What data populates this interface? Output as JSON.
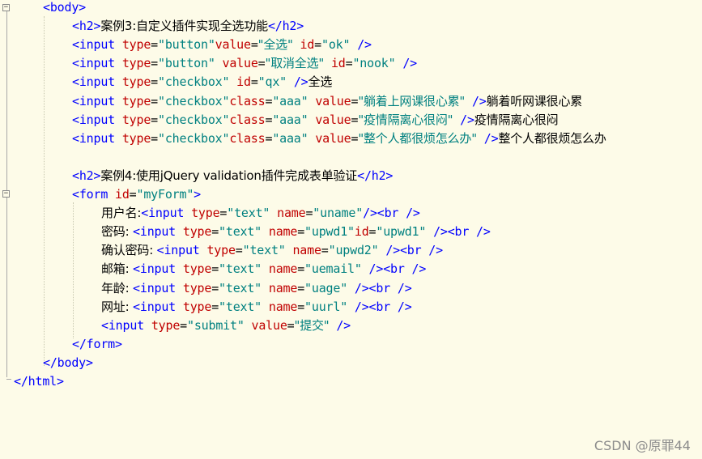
{
  "editor": {
    "lines": [
      {
        "indent": 1,
        "tokens": [
          [
            "tag",
            "<body>"
          ]
        ]
      },
      {
        "indent": 2,
        "tokens": [
          [
            "tag",
            "<h2>"
          ],
          [
            "txt",
            "案例3:自定义插件实现全选功能"
          ],
          [
            "tag",
            "</h2>"
          ]
        ]
      },
      {
        "indent": 2,
        "tokens": [
          [
            "tag",
            "<input "
          ],
          [
            "attr",
            "type"
          ],
          [
            "eq",
            "="
          ],
          [
            "val",
            "\"button\""
          ],
          [
            "attr",
            "value"
          ],
          [
            "eq",
            "="
          ],
          [
            "val",
            "\"全选\""
          ],
          [
            "txt",
            " "
          ],
          [
            "attr",
            "id"
          ],
          [
            "eq",
            "="
          ],
          [
            "val",
            "\"ok\""
          ],
          [
            "txt",
            " "
          ],
          [
            "tag",
            "/>"
          ]
        ]
      },
      {
        "indent": 2,
        "tokens": [
          [
            "tag",
            "<input "
          ],
          [
            "attr",
            "type"
          ],
          [
            "eq",
            "="
          ],
          [
            "val",
            "\"button\""
          ],
          [
            "txt",
            " "
          ],
          [
            "attr",
            "value"
          ],
          [
            "eq",
            "="
          ],
          [
            "val",
            "\"取消全选\""
          ],
          [
            "txt",
            " "
          ],
          [
            "attr",
            "id"
          ],
          [
            "eq",
            "="
          ],
          [
            "val",
            "\"nook\""
          ],
          [
            "txt",
            " "
          ],
          [
            "tag",
            "/>"
          ]
        ]
      },
      {
        "indent": 2,
        "tokens": [
          [
            "tag",
            "<input "
          ],
          [
            "attr",
            "type"
          ],
          [
            "eq",
            "="
          ],
          [
            "val",
            "\"checkbox\""
          ],
          [
            "txt",
            " "
          ],
          [
            "attr",
            "id"
          ],
          [
            "eq",
            "="
          ],
          [
            "val",
            "\"qx\""
          ],
          [
            "txt",
            " "
          ],
          [
            "tag",
            "/>"
          ],
          [
            "txt",
            "全选"
          ]
        ]
      },
      {
        "indent": 2,
        "tokens": [
          [
            "tag",
            "<input "
          ],
          [
            "attr",
            "type"
          ],
          [
            "eq",
            "="
          ],
          [
            "val",
            "\"checkbox\""
          ],
          [
            "attr",
            "class"
          ],
          [
            "eq",
            "="
          ],
          [
            "val",
            "\"aaa\""
          ],
          [
            "txt",
            " "
          ],
          [
            "attr",
            "value"
          ],
          [
            "eq",
            "="
          ],
          [
            "val",
            "\"躺着上网课很心累\""
          ],
          [
            "txt",
            " "
          ],
          [
            "tag",
            "/>"
          ],
          [
            "txt",
            "躺着听网课很心累"
          ]
        ]
      },
      {
        "indent": 2,
        "tokens": [
          [
            "tag",
            "<input "
          ],
          [
            "attr",
            "type"
          ],
          [
            "eq",
            "="
          ],
          [
            "val",
            "\"checkbox\""
          ],
          [
            "attr",
            "class"
          ],
          [
            "eq",
            "="
          ],
          [
            "val",
            "\"aaa\""
          ],
          [
            "txt",
            " "
          ],
          [
            "attr",
            "value"
          ],
          [
            "eq",
            "="
          ],
          [
            "val",
            "\"疫情隔离心很闷\""
          ],
          [
            "txt",
            " "
          ],
          [
            "tag",
            "/>"
          ],
          [
            "txt",
            "疫情隔离心很闷"
          ]
        ]
      },
      {
        "indent": 2,
        "tokens": [
          [
            "tag",
            "<input "
          ],
          [
            "attr",
            "type"
          ],
          [
            "eq",
            "="
          ],
          [
            "val",
            "\"checkbox\""
          ],
          [
            "attr",
            "class"
          ],
          [
            "eq",
            "="
          ],
          [
            "val",
            "\"aaa\""
          ],
          [
            "txt",
            " "
          ],
          [
            "attr",
            "value"
          ],
          [
            "eq",
            "="
          ],
          [
            "val",
            "\"整个人都很烦怎么办\""
          ],
          [
            "txt",
            " "
          ],
          [
            "tag",
            "/>"
          ],
          [
            "txt",
            "整个人都很烦怎么办"
          ]
        ]
      },
      {
        "indent": 0,
        "tokens": []
      },
      {
        "indent": 2,
        "tokens": [
          [
            "tag",
            "<h2>"
          ],
          [
            "txt",
            "案例4:使用jQuery validation插件完成表单验证"
          ],
          [
            "tag",
            "</h2>"
          ]
        ]
      },
      {
        "indent": 2,
        "tokens": [
          [
            "tag",
            "<form "
          ],
          [
            "attr",
            "id"
          ],
          [
            "eq",
            "="
          ],
          [
            "val",
            "\"myForm\""
          ],
          [
            "tag",
            ">"
          ]
        ]
      },
      {
        "indent": 3,
        "tokens": [
          [
            "txt",
            "用户名:"
          ],
          [
            "tag",
            "<input "
          ],
          [
            "attr",
            "type"
          ],
          [
            "eq",
            "="
          ],
          [
            "val",
            "\"text\""
          ],
          [
            "txt",
            " "
          ],
          [
            "attr",
            "name"
          ],
          [
            "eq",
            "="
          ],
          [
            "val",
            "\"uname\""
          ],
          [
            "tag",
            "/><br />"
          ]
        ]
      },
      {
        "indent": 3,
        "tokens": [
          [
            "txt",
            "密码: "
          ],
          [
            "tag",
            "<input "
          ],
          [
            "attr",
            "type"
          ],
          [
            "eq",
            "="
          ],
          [
            "val",
            "\"text\""
          ],
          [
            "txt",
            " "
          ],
          [
            "attr",
            "name"
          ],
          [
            "eq",
            "="
          ],
          [
            "val",
            "\"upwd1\""
          ],
          [
            "attr",
            "id"
          ],
          [
            "eq",
            "="
          ],
          [
            "val",
            "\"upwd1\""
          ],
          [
            "txt",
            " "
          ],
          [
            "tag",
            "/><br />"
          ]
        ]
      },
      {
        "indent": 3,
        "tokens": [
          [
            "txt",
            "确认密码: "
          ],
          [
            "tag",
            "<input "
          ],
          [
            "attr",
            "type"
          ],
          [
            "eq",
            "="
          ],
          [
            "val",
            "\"text\""
          ],
          [
            "txt",
            " "
          ],
          [
            "attr",
            "name"
          ],
          [
            "eq",
            "="
          ],
          [
            "val",
            "\"upwd2\""
          ],
          [
            "txt",
            " "
          ],
          [
            "tag",
            "/><br />"
          ]
        ]
      },
      {
        "indent": 3,
        "tokens": [
          [
            "txt",
            "邮箱: "
          ],
          [
            "tag",
            "<input "
          ],
          [
            "attr",
            "type"
          ],
          [
            "eq",
            "="
          ],
          [
            "val",
            "\"text\""
          ],
          [
            "txt",
            " "
          ],
          [
            "attr",
            "name"
          ],
          [
            "eq",
            "="
          ],
          [
            "val",
            "\"uemail\""
          ],
          [
            "txt",
            " "
          ],
          [
            "tag",
            "/><br />"
          ]
        ]
      },
      {
        "indent": 3,
        "tokens": [
          [
            "txt",
            "年龄: "
          ],
          [
            "tag",
            "<input "
          ],
          [
            "attr",
            "type"
          ],
          [
            "eq",
            "="
          ],
          [
            "val",
            "\"text\""
          ],
          [
            "txt",
            " "
          ],
          [
            "attr",
            "name"
          ],
          [
            "eq",
            "="
          ],
          [
            "val",
            "\"uage\""
          ],
          [
            "txt",
            " "
          ],
          [
            "tag",
            "/><br />"
          ]
        ]
      },
      {
        "indent": 3,
        "tokens": [
          [
            "txt",
            "网址: "
          ],
          [
            "tag",
            "<input "
          ],
          [
            "attr",
            "type"
          ],
          [
            "eq",
            "="
          ],
          [
            "val",
            "\"text\""
          ],
          [
            "txt",
            " "
          ],
          [
            "attr",
            "name"
          ],
          [
            "eq",
            "="
          ],
          [
            "val",
            "\"uurl\""
          ],
          [
            "txt",
            " "
          ],
          [
            "tag",
            "/><br />"
          ]
        ]
      },
      {
        "indent": 3,
        "tokens": [
          [
            "tag",
            "<input "
          ],
          [
            "attr",
            "type"
          ],
          [
            "eq",
            "="
          ],
          [
            "val",
            "\"submit\""
          ],
          [
            "txt",
            " "
          ],
          [
            "attr",
            "value"
          ],
          [
            "eq",
            "="
          ],
          [
            "val",
            "\"提交\""
          ],
          [
            "txt",
            " "
          ],
          [
            "tag",
            "/>"
          ]
        ]
      },
      {
        "indent": 2,
        "tokens": [
          [
            "tag",
            "</form>"
          ]
        ]
      },
      {
        "indent": 1,
        "tokens": [
          [
            "tag",
            "</body>"
          ]
        ]
      },
      {
        "indent": 0,
        "tokens": [
          [
            "tag",
            "</html>"
          ]
        ]
      }
    ],
    "fold_markers": [
      "minus-icon",
      "minus-icon"
    ]
  },
  "watermark": "CSDN @原罪44",
  "colors": {
    "background": "#fdfbe8",
    "tag": "#0000ff",
    "attribute": "#c00000",
    "value": "#008080",
    "text": "#000000"
  }
}
